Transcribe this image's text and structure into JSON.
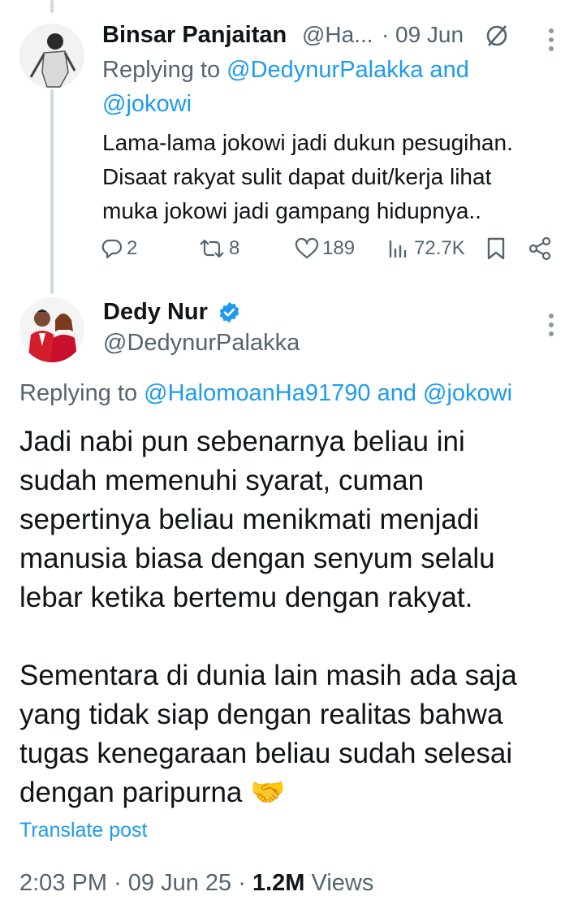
{
  "reply_tweet": {
    "display_name": "Binsar Panjaitan",
    "handle_truncated": "@Ha...",
    "separator": "·",
    "date": "09 Jun",
    "replying_prefix": "Replying to",
    "replying_line1": "@DedynurPalakka and",
    "replying_line2": "@jokowi",
    "text_lines": [
      "Lama-lama jokowi jadi dukun pesugihan.",
      "Disaat rakyat sulit dapat duit/kerja lihat",
      "muka jokowi jadi gampang hidupnya.."
    ],
    "actions": {
      "replies": "2",
      "reposts": "8",
      "likes": "189",
      "views": "72.7K"
    },
    "icons": [
      "muted-icon",
      "more-icon",
      "reply-icon",
      "repost-icon",
      "like-icon",
      "views-icon",
      "bookmark-icon",
      "share-icon"
    ]
  },
  "main_tweet": {
    "display_name": "Dedy Nur",
    "handle": "@DedynurPalakka",
    "verified": true,
    "replying_prefix": "Replying to",
    "replying_user1": "@HalomoanHa91790",
    "replying_and": "and",
    "replying_user2": "@jokowi",
    "paragraph1": [
      "Jadi nabi pun sebenarnya beliau ini",
      "sudah memenuhi syarat, cuman",
      "sepertinya beliau menikmati menjadi",
      "manusia biasa dengan senyum selalu",
      "lebar ketika bertemu dengan rakyat."
    ],
    "paragraph2": [
      "Sementara di dunia lain masih ada saja",
      "yang tidak siap dengan realitas bahwa",
      "tugas kenegaraan beliau sudah selesai",
      "dengan paripurna"
    ],
    "emoji": "🤝",
    "translate_label": "Translate post",
    "time": "2:03 PM",
    "separator": "·",
    "date": "09 Jun 25",
    "views_count": "1.2M",
    "views_label": "Views"
  },
  "colors": {
    "accent": "#1d9bf0",
    "text": "#0f1419",
    "secondary": "#536471",
    "thread_line": "#cfd9de"
  }
}
